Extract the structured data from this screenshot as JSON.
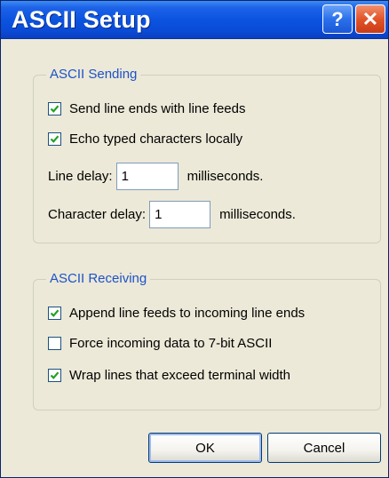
{
  "window": {
    "title": "ASCII Setup",
    "help_label": "?",
    "close_label": "✕"
  },
  "sending": {
    "legend": "ASCII Sending",
    "send_line_ends": {
      "label": "Send line ends with line feeds",
      "checked": true
    },
    "echo_typed": {
      "label": "Echo typed characters locally",
      "checked": true
    },
    "line_delay": {
      "label": "Line delay:",
      "value": "1",
      "unit": "milliseconds."
    },
    "char_delay": {
      "label": "Character delay:",
      "value": "1",
      "unit": "milliseconds."
    }
  },
  "receiving": {
    "legend": "ASCII Receiving",
    "append_line_feeds": {
      "label": "Append line feeds to incoming line ends",
      "checked": true
    },
    "force_7bit": {
      "label": "Force incoming data to 7-bit ASCII",
      "checked": false
    },
    "wrap_lines": {
      "label": "Wrap lines that exceed terminal width",
      "checked": true
    }
  },
  "buttons": {
    "ok": "OK",
    "cancel": "Cancel"
  },
  "colors": {
    "check": "#21a121",
    "legend": "#1d52c8"
  }
}
